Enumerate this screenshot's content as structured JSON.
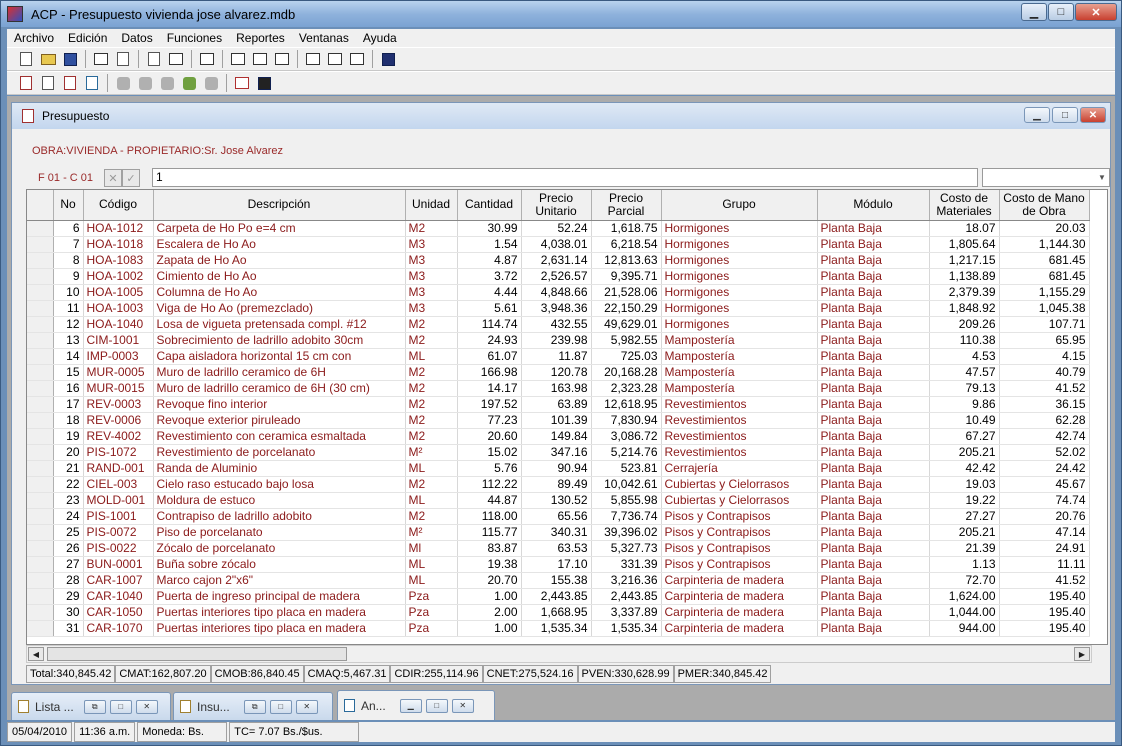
{
  "window": {
    "title": "ACP - Presupuesto vivienda jose alvarez.mdb",
    "min": "▁",
    "max": "□",
    "close": "✕"
  },
  "menu": [
    "Archivo",
    "Edición",
    "Datos",
    "Funciones",
    "Reportes",
    "Ventanas",
    "Ayuda"
  ],
  "child": {
    "title": "Presupuesto",
    "obra": "OBRA:VIVIENDA - PROPIETARIO:Sr. Jose Alvarez",
    "cellref": "F 01 - C 01",
    "edit_value": "1",
    "cancel": "✕",
    "accept": "✓"
  },
  "columns": [
    "No",
    "Código",
    "Descripción",
    "Unidad",
    "Cantidad",
    "Precio Unitario",
    "Precio Parcial",
    "Grupo",
    "Módulo",
    "Costo de Materiales",
    "Costo de Mano de Obra"
  ],
  "rows": [
    [
      "6",
      "HOA-1012",
      "Carpeta de Ho Po e=4 cm",
      "M2",
      "30.99",
      "52.24",
      "1,618.75",
      "Hormigones",
      "Planta Baja",
      "18.07",
      "20.03"
    ],
    [
      "7",
      "HOA-1018",
      "Escalera de Ho Ao",
      "M3",
      "1.54",
      "4,038.01",
      "6,218.54",
      "Hormigones",
      "Planta Baja",
      "1,805.64",
      "1,144.30"
    ],
    [
      "8",
      "HOA-1083",
      "Zapata de Ho Ao",
      "M3",
      "4.87",
      "2,631.14",
      "12,813.63",
      "Hormigones",
      "Planta Baja",
      "1,217.15",
      "681.45"
    ],
    [
      "9",
      "HOA-1002",
      "Cimiento de Ho Ao",
      "M3",
      "3.72",
      "2,526.57",
      "9,395.71",
      "Hormigones",
      "Planta Baja",
      "1,138.89",
      "681.45"
    ],
    [
      "10",
      "HOA-1005",
      "Columna de Ho Ao",
      "M3",
      "4.44",
      "4,848.66",
      "21,528.06",
      "Hormigones",
      "Planta Baja",
      "2,379.39",
      "1,155.29"
    ],
    [
      "11",
      "HOA-1003",
      "Viga de Ho Ao (premezclado)",
      "M3",
      "5.61",
      "3,948.36",
      "22,150.29",
      "Hormigones",
      "Planta Baja",
      "1,848.92",
      "1,045.38"
    ],
    [
      "12",
      "HOA-1040",
      "Losa de vigueta pretensada compl. #12",
      "M2",
      "114.74",
      "432.55",
      "49,629.01",
      "Hormigones",
      "Planta Baja",
      "209.26",
      "107.71"
    ],
    [
      "13",
      "CIM-1001",
      "Sobrecimiento de ladrillo adobito 30cm",
      "M2",
      "24.93",
      "239.98",
      "5,982.55",
      "Mampostería",
      "Planta Baja",
      "110.38",
      "65.95"
    ],
    [
      "14",
      "IMP-0003",
      "Capa aisladora horizontal 15 cm con",
      "ML",
      "61.07",
      "11.87",
      "725.03",
      "Mampostería",
      "Planta Baja",
      "4.53",
      "4.15"
    ],
    [
      "15",
      "MUR-0005",
      "Muro de ladrillo ceramico de 6H",
      "M2",
      "166.98",
      "120.78",
      "20,168.28",
      "Mampostería",
      "Planta Baja",
      "47.57",
      "40.79"
    ],
    [
      "16",
      "MUR-0015",
      "Muro de ladrillo ceramico de 6H (30 cm)",
      "M2",
      "14.17",
      "163.98",
      "2,323.28",
      "Mampostería",
      "Planta Baja",
      "79.13",
      "41.52"
    ],
    [
      "17",
      "REV-0003",
      "Revoque fino interior",
      "M2",
      "197.52",
      "63.89",
      "12,618.95",
      "Revestimientos",
      "Planta Baja",
      "9.86",
      "36.15"
    ],
    [
      "18",
      "REV-0006",
      "Revoque exterior piruleado",
      "M2",
      "77.23",
      "101.39",
      "7,830.94",
      "Revestimientos",
      "Planta Baja",
      "10.49",
      "62.28"
    ],
    [
      "19",
      "REV-4002",
      "Revestimiento con ceramica esmaltada",
      "M2",
      "20.60",
      "149.84",
      "3,086.72",
      "Revestimientos",
      "Planta Baja",
      "67.27",
      "42.74"
    ],
    [
      "20",
      "PIS-1072",
      "Revestimiento de porcelanato",
      "M²",
      "15.02",
      "347.16",
      "5,214.76",
      "Revestimientos",
      "Planta Baja",
      "205.21",
      "52.02"
    ],
    [
      "21",
      "RAND-001",
      "Randa de Aluminio",
      "ML",
      "5.76",
      "90.94",
      "523.81",
      "Cerrajería",
      "Planta Baja",
      "42.42",
      "24.42"
    ],
    [
      "22",
      "CIEL-003",
      "Cielo raso estucado bajo losa",
      "M2",
      "112.22",
      "89.49",
      "10,042.61",
      "Cubiertas y Cielorrasos",
      "Planta Baja",
      "19.03",
      "45.67"
    ],
    [
      "23",
      "MOLD-001",
      "Moldura de estuco",
      "ML",
      "44.87",
      "130.52",
      "5,855.98",
      "Cubiertas y Cielorrasos",
      "Planta Baja",
      "19.22",
      "74.74"
    ],
    [
      "24",
      "PIS-1001",
      "Contrapiso de ladrillo adobito",
      "M2",
      "118.00",
      "65.56",
      "7,736.74",
      "Pisos y Contrapisos",
      "Planta Baja",
      "27.27",
      "20.76"
    ],
    [
      "25",
      "PIS-0072",
      "Piso de porcelanato",
      "M²",
      "115.77",
      "340.31",
      "39,396.02",
      "Pisos y Contrapisos",
      "Planta Baja",
      "205.21",
      "47.14"
    ],
    [
      "26",
      "PIS-0022",
      "Zócalo de porcelanato",
      "Ml",
      "83.87",
      "63.53",
      "5,327.73",
      "Pisos y Contrapisos",
      "Planta Baja",
      "21.39",
      "24.91"
    ],
    [
      "27",
      "BUN-0001",
      "Buña sobre zócalo",
      "ML",
      "19.38",
      "17.10",
      "331.39",
      "Pisos y Contrapisos",
      "Planta Baja",
      "1.13",
      "11.11"
    ],
    [
      "28",
      "CAR-1007",
      "Marco cajon 2\"x6\"",
      "ML",
      "20.70",
      "155.38",
      "3,216.36",
      "Carpinteria de madera",
      "Planta Baja",
      "72.70",
      "41.52"
    ],
    [
      "29",
      "CAR-1040",
      "Puerta de ingreso principal de madera",
      "Pza",
      "1.00",
      "2,443.85",
      "2,443.85",
      "Carpinteria de madera",
      "Planta Baja",
      "1,624.00",
      "195.40"
    ],
    [
      "30",
      "CAR-1050",
      "Puertas interiores tipo placa en madera",
      "Pza",
      "2.00",
      "1,668.95",
      "3,337.89",
      "Carpinteria de madera",
      "Planta Baja",
      "1,044.00",
      "195.40"
    ],
    [
      "31",
      "CAR-1070",
      "Puertas interiores tipo placa en madera",
      "Pza",
      "1.00",
      "1,535.34",
      "1,535.34",
      "Carpinteria de madera",
      "Planta Baja",
      "944.00",
      "195.40"
    ]
  ],
  "totals": [
    "Total:340,845.42",
    "CMAT:162,807.20",
    "CMOB:86,840.45",
    "CMAQ:5,467.31",
    "CDIR:255,114.96",
    "CNET:275,524.16",
    "PVEN:330,628.99",
    "PMER:340,845.42"
  ],
  "tabs": [
    {
      "label": "Lista ..."
    },
    {
      "label": "Insu..."
    },
    {
      "label": "An..."
    }
  ],
  "status": [
    "05/04/2010",
    "11:36 a.m.",
    "Moneda: Bs.",
    "TC= 7.07 Bs./$us."
  ]
}
